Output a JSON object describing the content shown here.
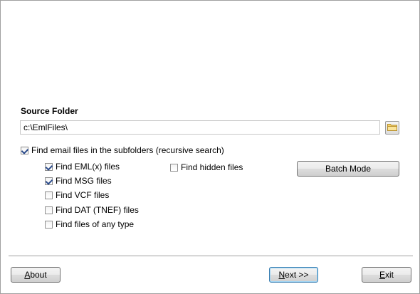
{
  "source": {
    "label": "Source Folder",
    "path": "c:\\EmlFiles\\",
    "browse_icon": "folder-icon"
  },
  "options": {
    "recursive": {
      "label": "Find email files in the subfolders (recursive search)",
      "checked": true
    },
    "eml": {
      "label": "Find EML(x) files",
      "checked": true
    },
    "msg": {
      "label": "Find MSG files",
      "checked": true
    },
    "vcf": {
      "label": "Find VCF files",
      "checked": false
    },
    "dat": {
      "label": "Find DAT (TNEF) files",
      "checked": false
    },
    "any": {
      "label": "Find files of any type",
      "checked": false
    },
    "hidden": {
      "label": "Find hidden files",
      "checked": false
    }
  },
  "buttons": {
    "batch_mode": "Batch Mode",
    "about_first": "A",
    "about_rest": "bout",
    "next_first": "N",
    "next_rest": "ext >>",
    "exit_first": "E",
    "exit_rest": "xit"
  }
}
